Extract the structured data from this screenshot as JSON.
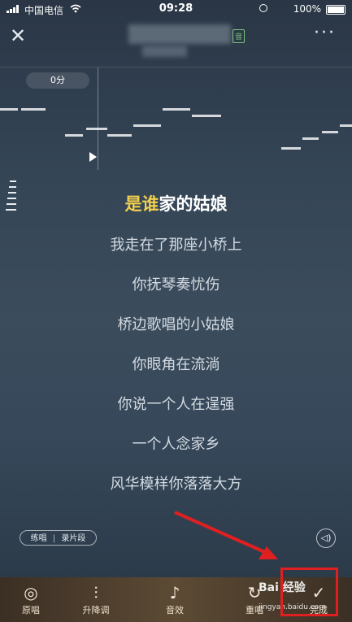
{
  "status_bar": {
    "carrier": "中国电信",
    "time": "09:28",
    "battery": "100%"
  },
  "header": {
    "badge": "音"
  },
  "pitch_bar": {
    "score": "0分"
  },
  "lyrics": {
    "current_highlight": "是谁",
    "current_rest": "家的姑娘",
    "lines": [
      "我走在了那座小桥上",
      "你抚琴奏忧伤",
      "桥边歌唱的小姑娘",
      "你眼角在流淌",
      "你说一个人在逞强",
      "一个人念家乡",
      "风华模样你落落大方"
    ]
  },
  "controls": {
    "practice": "练唱",
    "separator": "|",
    "record_segment": "录片段"
  },
  "tabs": [
    {
      "label": "原唱",
      "icon": "disc-icon"
    },
    {
      "label": "升降调",
      "icon": "sliders-icon"
    },
    {
      "label": "音效",
      "icon": "sound-effect-icon"
    },
    {
      "label": "重唱",
      "icon": "redo-icon"
    },
    {
      "label": "完成",
      "icon": "check-icon"
    }
  ],
  "watermark": {
    "main": "Bai 经验",
    "sub": "jingyan.baidu.com"
  },
  "colors": {
    "highlight": "#f2cf4e",
    "annotation": "#e02020"
  }
}
